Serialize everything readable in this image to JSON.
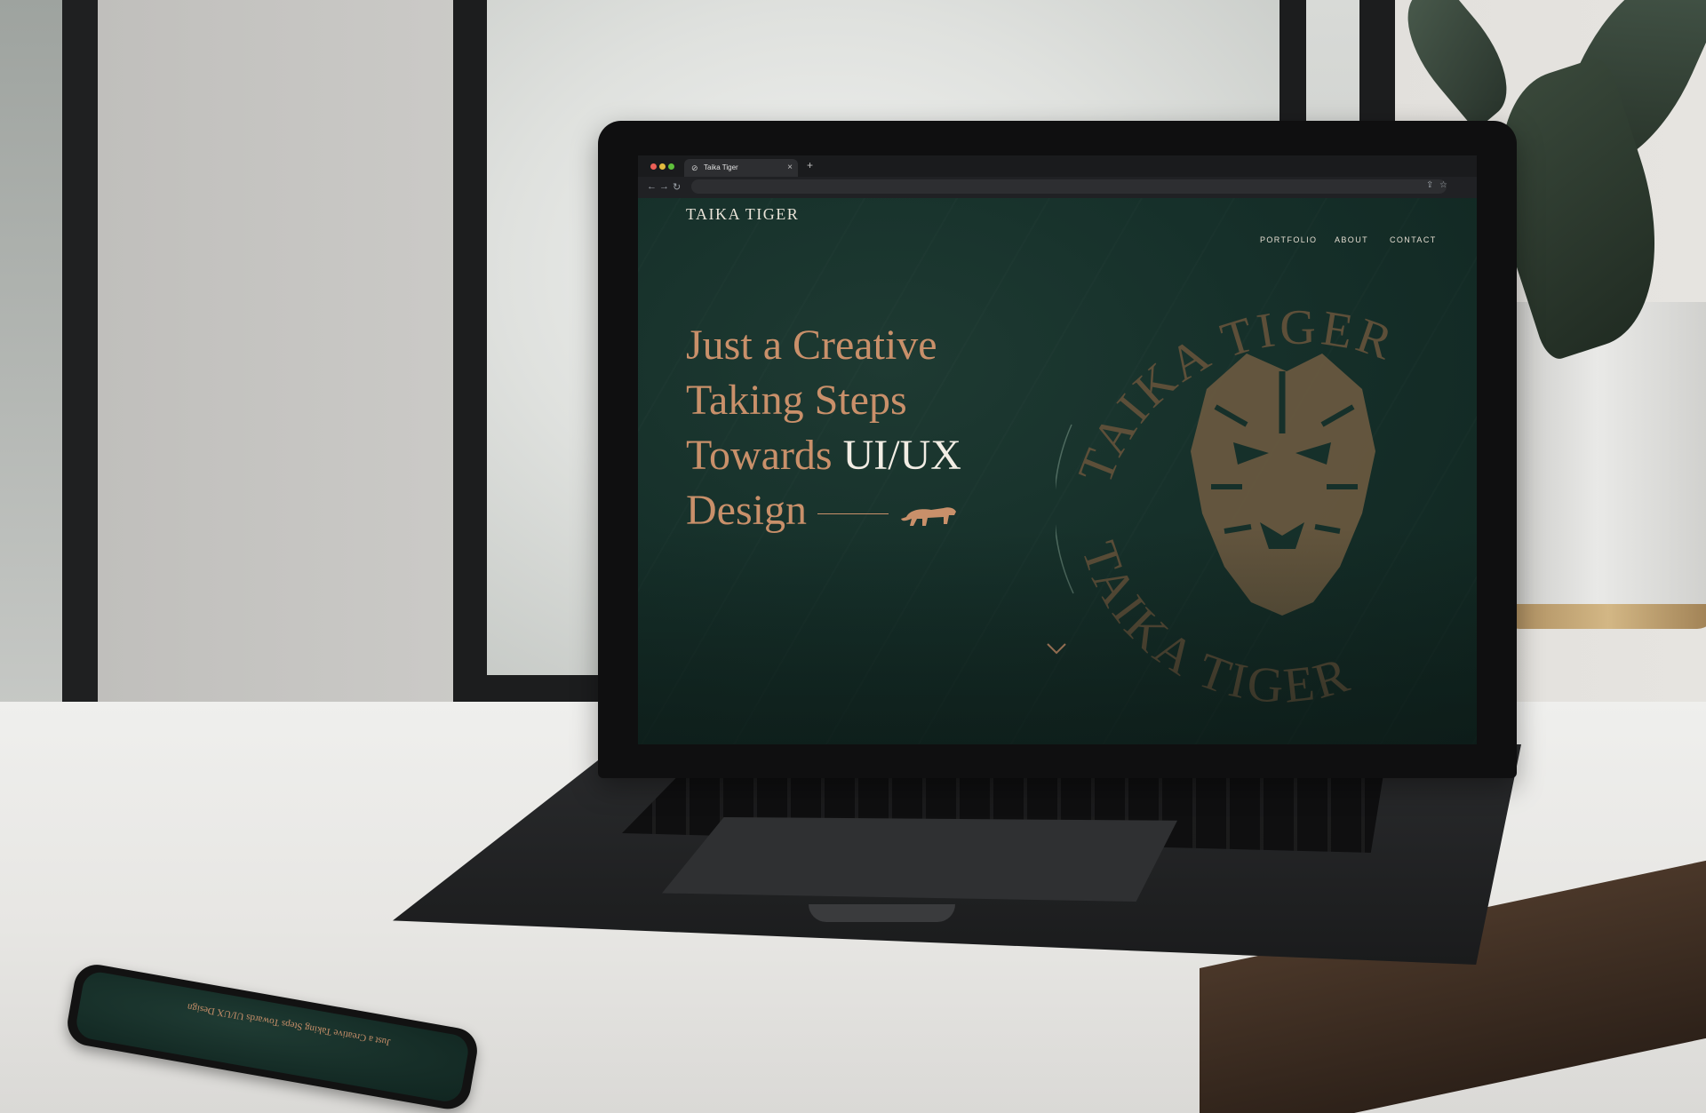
{
  "browser": {
    "tab_title": "Taika Tiger",
    "tab_favicon": "globe-icon",
    "tab_close": "×",
    "new_tab": "+",
    "nav_back": "←",
    "nav_forward": "→",
    "nav_reload": "↻",
    "url": "",
    "share_icon": "⇪",
    "star_icon": "☆"
  },
  "site": {
    "brand": "TAIKA TIGER",
    "nav": [
      "PORTFOLIO",
      "ABOUT",
      "CONTACT"
    ],
    "hero": {
      "line1": "Just a Creative",
      "line2": "Taking Steps",
      "line3_prefix": "Towards ",
      "line3_highlight": "UI/UX",
      "line4": "Design"
    },
    "emblem_text": "TAIKA TIGER",
    "colors": {
      "background": "#16302a",
      "accent": "#c9906a",
      "highlight": "#f2ede4",
      "emblem": "#6b5a40"
    }
  },
  "phone": {
    "hero_text": "Just a Creative Taking Steps Towards UI/UX Design"
  }
}
